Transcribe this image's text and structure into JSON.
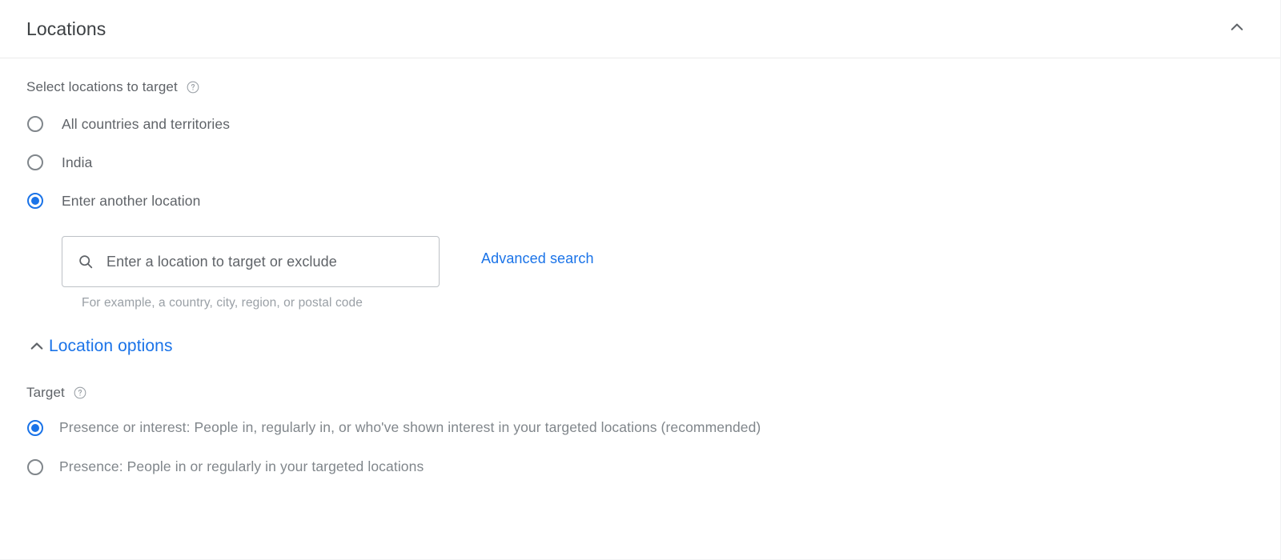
{
  "header": {
    "title": "Locations",
    "collapse_icon": "chevron-up-icon"
  },
  "locations": {
    "label": "Select locations to target",
    "help_icon": "help-circle-icon",
    "options": [
      {
        "label": "All countries and territories",
        "selected": false
      },
      {
        "label": "India",
        "selected": false
      },
      {
        "label": "Enter another location",
        "selected": true
      }
    ],
    "search": {
      "icon": "search-icon",
      "placeholder": "Enter a location to target or exclude",
      "value": "",
      "hint": "For example, a country, city, region, or postal code"
    },
    "advanced_search_label": "Advanced search"
  },
  "location_options": {
    "toggle_label": "Location options",
    "toggle_icon": "chevron-up-icon",
    "target": {
      "label": "Target",
      "help_icon": "help-circle-icon",
      "options": [
        {
          "label": "Presence or interest: People in, regularly in, or who've shown interest in your targeted locations (recommended)",
          "selected": true
        },
        {
          "label": "Presence: People in or regularly in your targeted locations",
          "selected": false
        }
      ]
    }
  },
  "colors": {
    "accent": "#1a73e8",
    "text_primary": "#3c4043",
    "text_secondary": "#5f6368",
    "text_muted": "#9aa0a6",
    "border": "#bdc1c6"
  }
}
